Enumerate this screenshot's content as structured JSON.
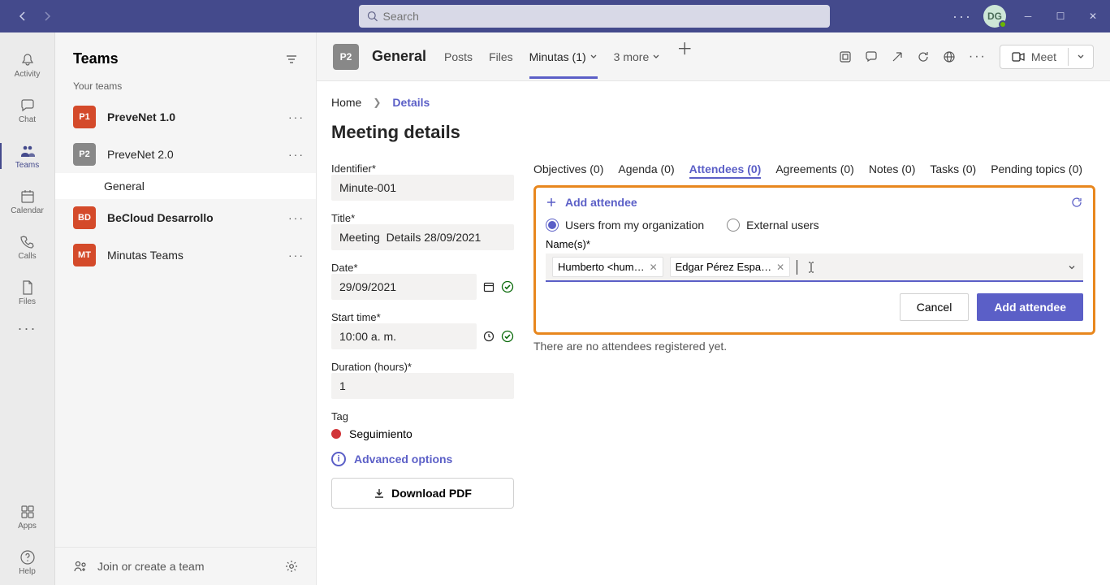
{
  "search": {
    "placeholder": "Search"
  },
  "avatar": {
    "initials": "DG"
  },
  "rail": {
    "activity": "Activity",
    "chat": "Chat",
    "teams": "Teams",
    "calendar": "Calendar",
    "calls": "Calls",
    "files": "Files",
    "apps": "Apps",
    "help": "Help"
  },
  "teams": {
    "title": "Teams",
    "your_teams": "Your teams",
    "items": [
      {
        "avatar": "P1",
        "name": "PreveNet 1.0",
        "color": "#d44a2a",
        "bold": true
      },
      {
        "avatar": "P2",
        "name": "PreveNet 2.0",
        "color": "#888888",
        "bold": false
      },
      {
        "avatar": "BD",
        "name": "BeCloud Desarrollo",
        "color": "#d44a2a",
        "bold": true
      },
      {
        "avatar": "MT",
        "name": "Minutas Teams",
        "color": "#d44a2a",
        "bold": false
      }
    ],
    "channel_general": "General",
    "join_create": "Join or create a team"
  },
  "channel": {
    "avatar": "P2",
    "title": "General",
    "tabs": {
      "posts": "Posts",
      "files": "Files",
      "minutas": "Minutas (1)",
      "more": "3 more"
    },
    "meet": "Meet"
  },
  "breadcrumb": {
    "home": "Home",
    "details": "Details"
  },
  "page": {
    "title": "Meeting details"
  },
  "form": {
    "identifier_label": "Identifier*",
    "identifier_value": "Minute-001",
    "title_label": "Title*",
    "title_value": "Meeting  Details 28/09/2021",
    "date_label": "Date*",
    "date_value": "29/09/2021",
    "start_label": "Start time*",
    "start_value": "10:00 a. m.",
    "duration_label": "Duration (hours)*",
    "duration_value": "1",
    "tag_label": "Tag",
    "tag_value": "Seguimiento",
    "advanced": "Advanced options",
    "download": "Download PDF"
  },
  "detail_tabs": {
    "objectives": "Objectives (0)",
    "agenda": "Agenda (0)",
    "attendees": "Attendees (0)",
    "agreements": "Agreements (0)",
    "notes": "Notes (0)",
    "tasks": "Tasks (0)",
    "pending": "Pending topics (0)"
  },
  "attendee_panel": {
    "add_link": "Add attendee",
    "users_org": "Users from my organization",
    "external": "External users",
    "names_label": "Name(s)*",
    "chips": [
      "Humberto <hum…",
      "Edgar Pérez Espa…"
    ],
    "cancel": "Cancel",
    "add_btn": "Add attendee",
    "empty": "There are no attendees registered yet."
  }
}
